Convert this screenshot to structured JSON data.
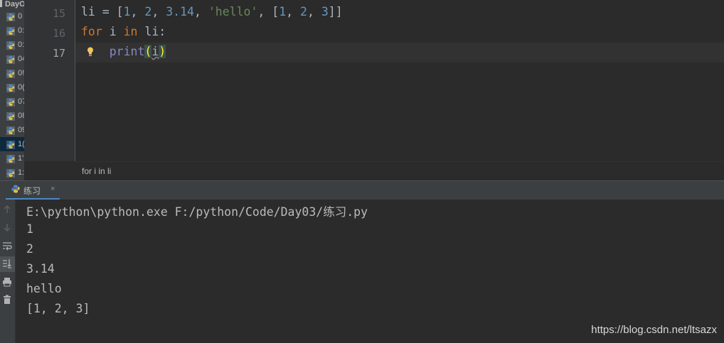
{
  "project_tree": {
    "folder_label": "DayO",
    "items": [
      {
        "label": "0"
      },
      {
        "label": "0:"
      },
      {
        "label": "0:"
      },
      {
        "label": "04"
      },
      {
        "label": "0!"
      },
      {
        "label": "0("
      },
      {
        "label": "07"
      },
      {
        "label": "08"
      },
      {
        "label": "09"
      },
      {
        "label": "1("
      },
      {
        "label": "1'"
      },
      {
        "label": "1:"
      }
    ],
    "selected_index": 9
  },
  "editor": {
    "line_numbers": [
      "15",
      "16",
      "17"
    ],
    "current_line": "17",
    "line15": {
      "t1": "li = [",
      "n1": "1",
      "s1": ", ",
      "n2": "2",
      "s2": ", ",
      "n3": "3.14",
      "s3": ", ",
      "str": "'hello'",
      "s4": ", [",
      "n4": "1",
      "s5": ", ",
      "n5": "2",
      "s6": ", ",
      "n6": "3",
      "t2": "]]"
    },
    "line16": {
      "kw1": "for",
      "t1": " i ",
      "kw2": "in",
      "t2": " li:"
    },
    "line17": {
      "indent": "    ",
      "fn": "print",
      "open": "(",
      "arg": "i",
      "close": ")"
    }
  },
  "breadcrumb": "for i in li",
  "run": {
    "tab_label": "练习",
    "close": "×",
    "output": [
      "E:\\python\\python.exe F:/python/Code/Day03/练习.py",
      "1",
      "2",
      "3.14",
      "hello",
      "[1, 2, 3]"
    ],
    "toolbar": [
      "up-arrow-icon",
      "down-arrow-icon",
      "soft-wrap-icon",
      "scroll-to-end-icon",
      "print-icon",
      "trash-icon"
    ]
  },
  "watermark": "https://blog.csdn.net/ltsazx"
}
